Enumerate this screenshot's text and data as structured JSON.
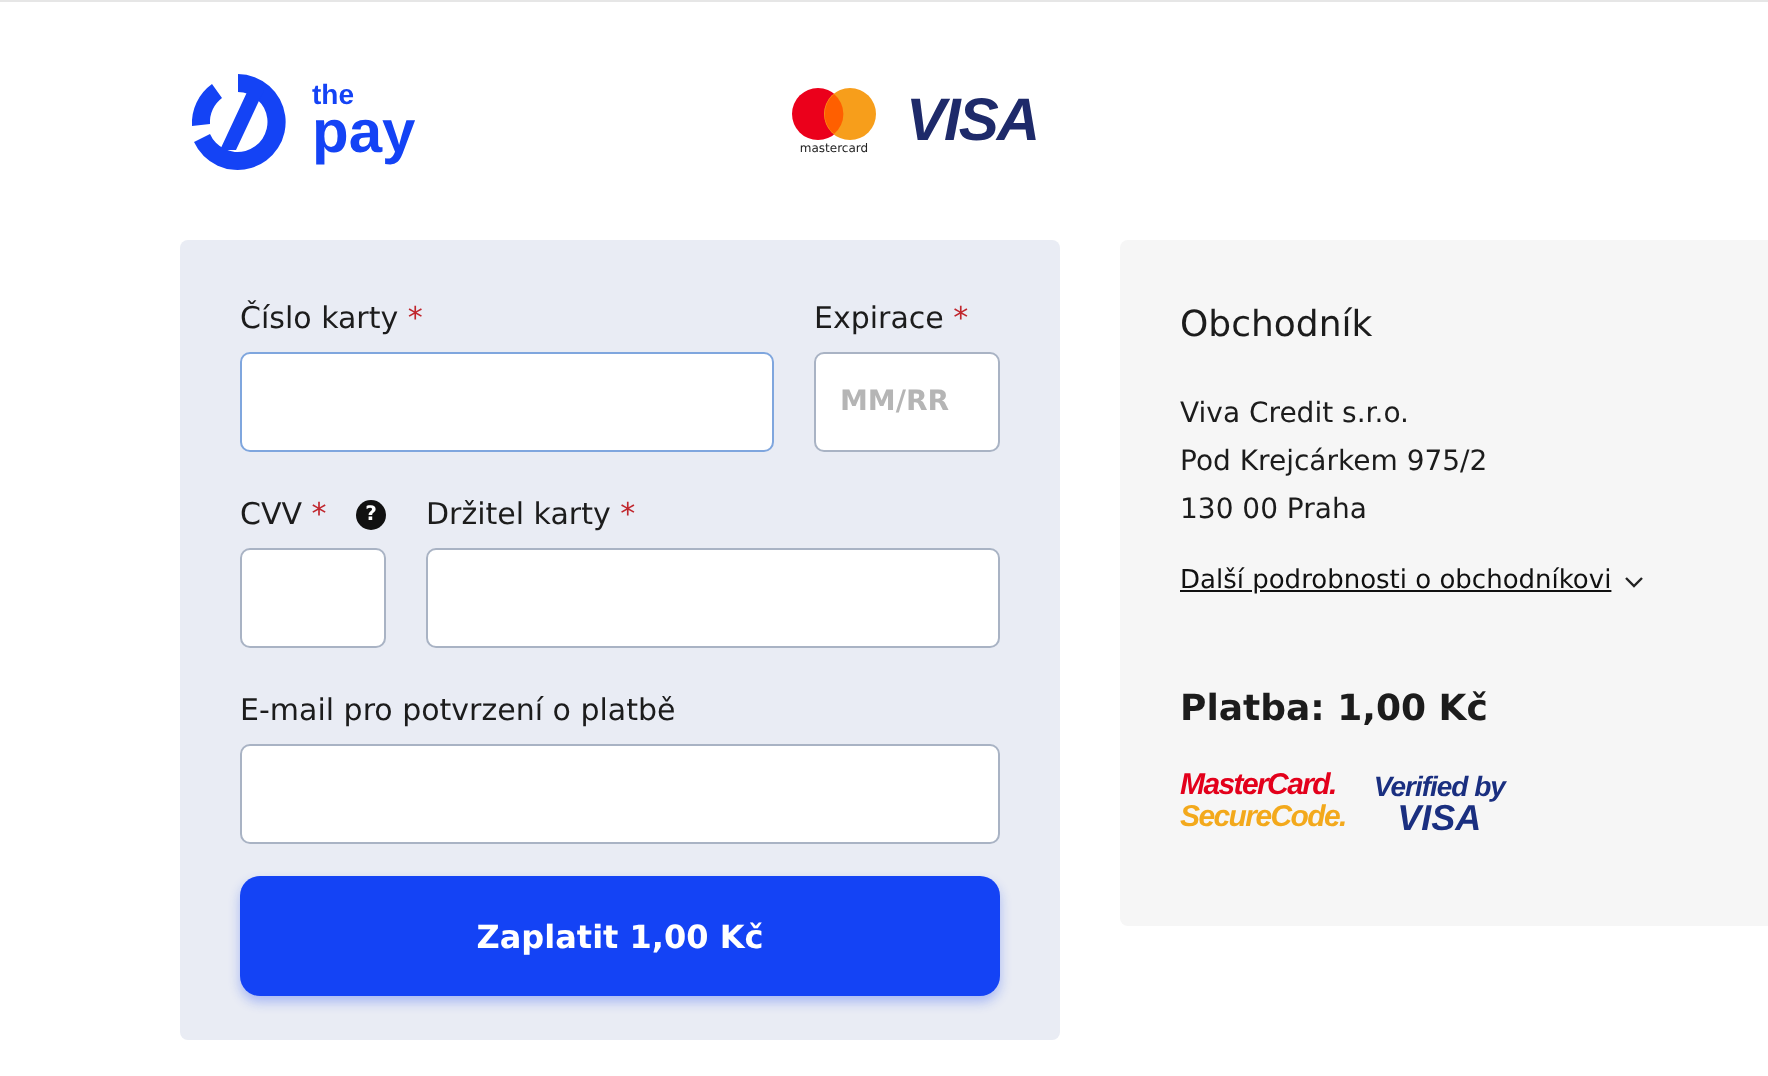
{
  "header": {
    "logo_small": "the",
    "logo_large": "pay",
    "mastercard_label": "mastercard",
    "visa_label": "VISA"
  },
  "form": {
    "fields": [
      {
        "label": "Číslo karty",
        "required": true,
        "focused": true,
        "help": false
      },
      {
        "label": "Expirace",
        "required": true,
        "placeholder": "MM/RR",
        "focused": false,
        "help": false
      },
      {
        "label": "CVV",
        "required": true,
        "focused": false,
        "help": true
      },
      {
        "label": "Držitel karty",
        "required": true,
        "focused": false,
        "help": false
      },
      {
        "label": "E-mail pro potvrzení o platbě",
        "required": false,
        "focused": false,
        "help": false
      }
    ],
    "required_mark": "*",
    "help_glyph": "?",
    "submit": "Zaplatit 1,00 Kč"
  },
  "merchant": {
    "title": "Obchodník",
    "lines": [
      "Viva Credit s.r.o.",
      "Pod Krejcárkem 975/2",
      "130 00 Praha"
    ],
    "details_link": "Další podrobnosti o obchodníkovi",
    "expanded": false,
    "payment": "Platba: 1,00 Kč",
    "secure_badges": {
      "mc_top": "MasterCard.",
      "mc_bottom": "SecureCode.",
      "visa_top": "Verified by",
      "visa_bottom": "VISA"
    }
  }
}
